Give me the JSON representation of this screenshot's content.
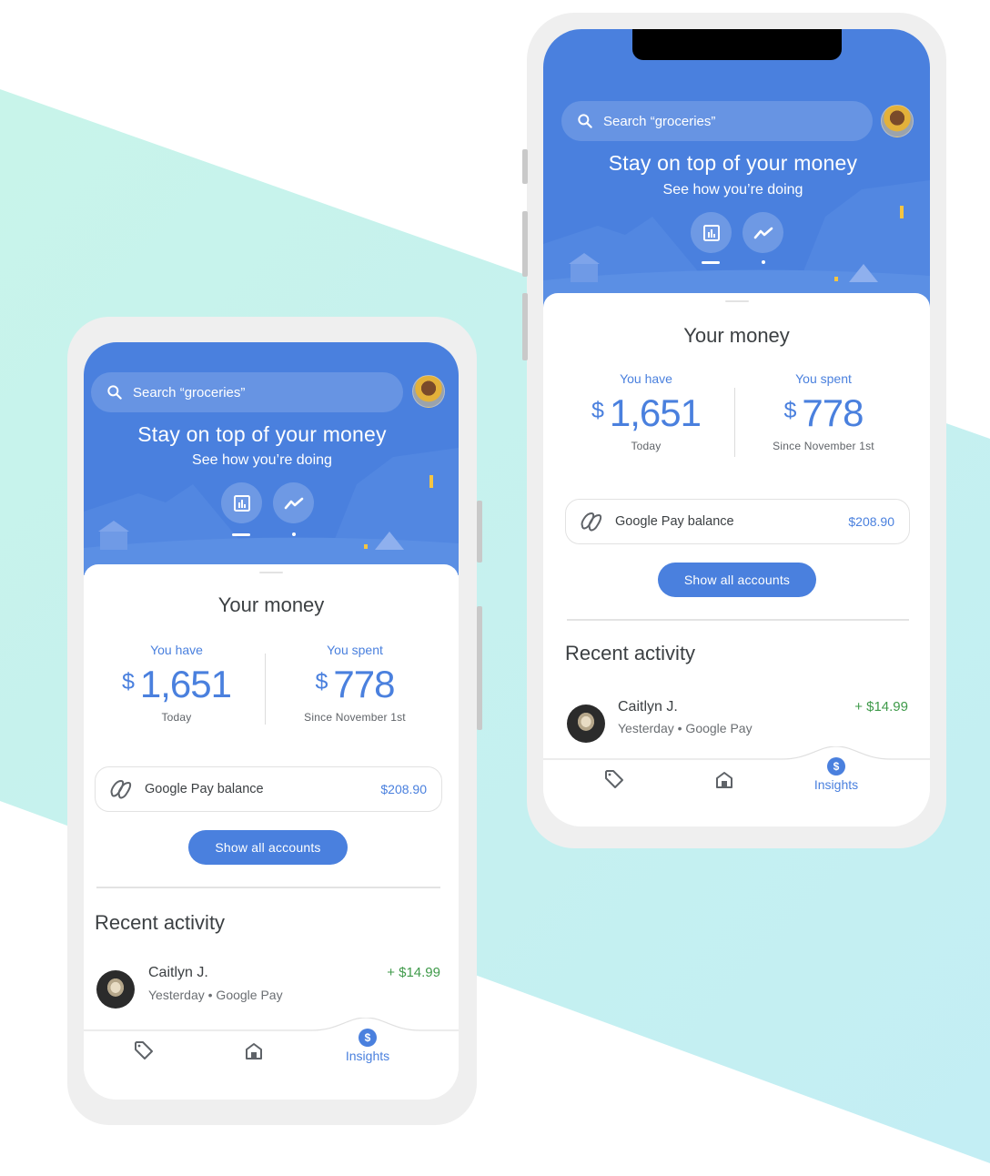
{
  "colors": {
    "accent": "#4a80de",
    "positive": "#3f9a4a",
    "background_band": "#c6f0ef",
    "frame": "#efefef"
  },
  "search": {
    "placeholder": "Search “groceries”",
    "icon": "search-icon"
  },
  "hero": {
    "title": "Stay on top of your money",
    "subtitle": "See how you’re doing",
    "buttons": [
      {
        "icon": "bar-chart-icon",
        "active": true
      },
      {
        "icon": "trending-line-icon",
        "active": false
      }
    ]
  },
  "money": {
    "title": "Your money",
    "have": {
      "label": "You have",
      "currency": "$",
      "amount": "1,651",
      "caption": "Today"
    },
    "spent": {
      "label": "You spent",
      "currency": "$",
      "amount": "778",
      "caption": "Since November 1st"
    }
  },
  "gpay": {
    "icon": "google-pay-icon",
    "label": "Google Pay balance",
    "amount": "$208.90"
  },
  "accounts_button": "Show all accounts",
  "recent": {
    "title": "Recent activity",
    "items": [
      {
        "name": "Caitlyn J.",
        "meta": "Yesterday • Google Pay",
        "amount": "+ $14.99"
      }
    ]
  },
  "nav": {
    "items": [
      {
        "icon": "tag-icon",
        "label": ""
      },
      {
        "icon": "home-icon",
        "label": ""
      },
      {
        "icon": "dollar-icon",
        "badge": "$",
        "label": "Insights",
        "active": true
      }
    ]
  }
}
